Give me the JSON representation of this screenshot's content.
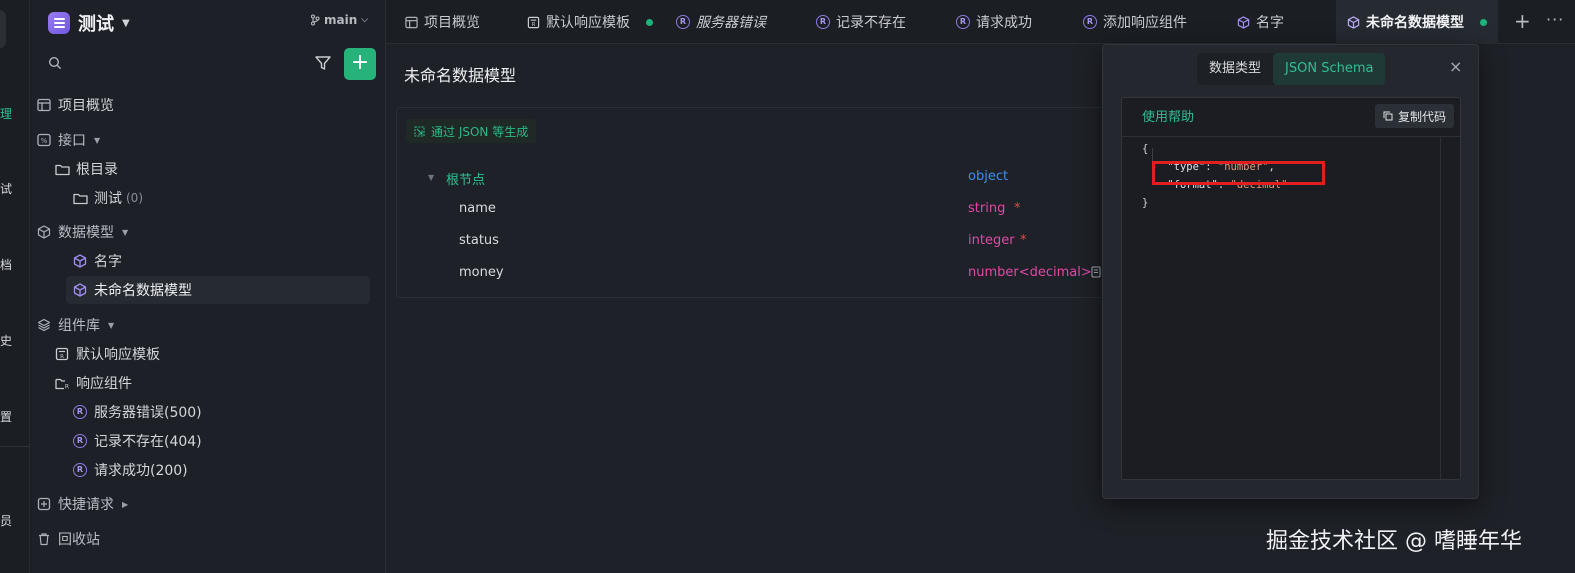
{
  "rail": {
    "stubs": [
      "理",
      "试",
      "档",
      "史",
      "置",
      "员"
    ]
  },
  "sidebar": {
    "project_name": "测试",
    "items": [
      {
        "label": "项目概览",
        "count": ""
      },
      {
        "label": "接口",
        "count": ""
      },
      {
        "label": "根目录",
        "count": ""
      },
      {
        "label": "测试",
        "count": "(0)"
      },
      {
        "label": "数据模型",
        "count": ""
      },
      {
        "label": "名字",
        "count": ""
      },
      {
        "label": "未命名数据模型",
        "count": ""
      },
      {
        "label": "组件库",
        "count": ""
      },
      {
        "label": "默认响应模板",
        "count": ""
      },
      {
        "label": "响应组件",
        "count": ""
      },
      {
        "label": "服务器错误(500)",
        "count": ""
      },
      {
        "label": "记录不存在(404)",
        "count": ""
      },
      {
        "label": "请求成功(200)",
        "count": ""
      },
      {
        "label": "快捷请求",
        "count": ""
      },
      {
        "label": "回收站",
        "count": ""
      }
    ],
    "add_label": "+"
  },
  "tabbar": {
    "branch": "main",
    "tabs": [
      {
        "label": "项目概览"
      },
      {
        "label": "默认响应模板"
      },
      {
        "label": "服务器错误"
      },
      {
        "label": "记录不存在"
      },
      {
        "label": "请求成功"
      },
      {
        "label": "添加响应组件"
      },
      {
        "label": "名字"
      },
      {
        "label": "未命名数据模型"
      }
    ],
    "plus": "+",
    "more": "···"
  },
  "main": {
    "title": "未命名数据模型",
    "gen_button": "通过 JSON 等生成",
    "rows": [
      {
        "name": "根节点",
        "type": "object",
        "required": ""
      },
      {
        "name": "name",
        "type": "string",
        "required": "*"
      },
      {
        "name": "status",
        "type": "integer",
        "required": "*"
      },
      {
        "name": "money",
        "type": "number<decimal>",
        "required": ""
      }
    ]
  },
  "panel": {
    "seg_data_type": "数据类型",
    "seg_json_schema": "JSON Schema",
    "close": "×",
    "help": "使用帮助",
    "copy": "复制代码",
    "code": {
      "open": "{",
      "l1_key": "\"type\"",
      "l1_val": "\"number\"",
      "l2_key": "\"format\"",
      "l2_val": "\"decimal\"",
      "close": "}"
    }
  },
  "watermark": "掘金技术社区 @ 嗜睡年华",
  "colors": {
    "accent": "#27b27a",
    "schema_type": "#e247a8",
    "object_type": "#3d8ef0",
    "required": "#e5484d",
    "highlight": "#e02020"
  }
}
